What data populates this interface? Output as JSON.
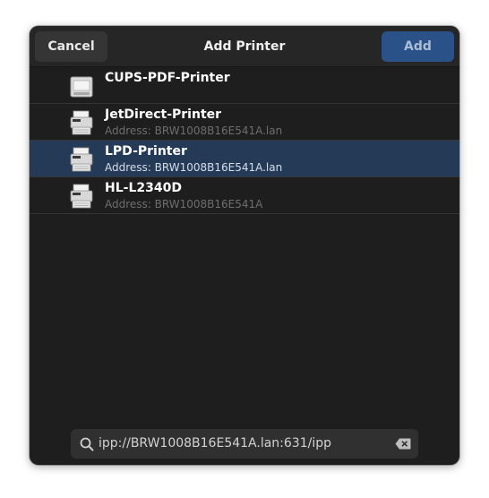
{
  "dialog": {
    "title": "Add Printer",
    "cancel_label": "Cancel",
    "add_label": "Add"
  },
  "printers": [
    {
      "name": "CUPS-PDF-Printer",
      "address": "",
      "icon": "pdf-printer-icon",
      "selected": false
    },
    {
      "name": "JetDirect-Printer",
      "address": "Address: BRW1008B16E541A.lan",
      "icon": "printer-icon",
      "selected": false
    },
    {
      "name": "LPD-Printer",
      "address": "Address: BRW1008B16E541A.lan",
      "icon": "printer-icon",
      "selected": true
    },
    {
      "name": "HL-L2340D",
      "address": "Address: BRW1008B16E541A",
      "icon": "printer-icon",
      "selected": false
    }
  ],
  "search": {
    "value": "ipp://BRW1008B16E541A.lan:631/ipp",
    "icon": "search-icon",
    "clear_icon": "clear-icon"
  },
  "colors": {
    "accent": "#2a5288",
    "selected_row": "#243a56",
    "background": "#1e1e1e"
  }
}
